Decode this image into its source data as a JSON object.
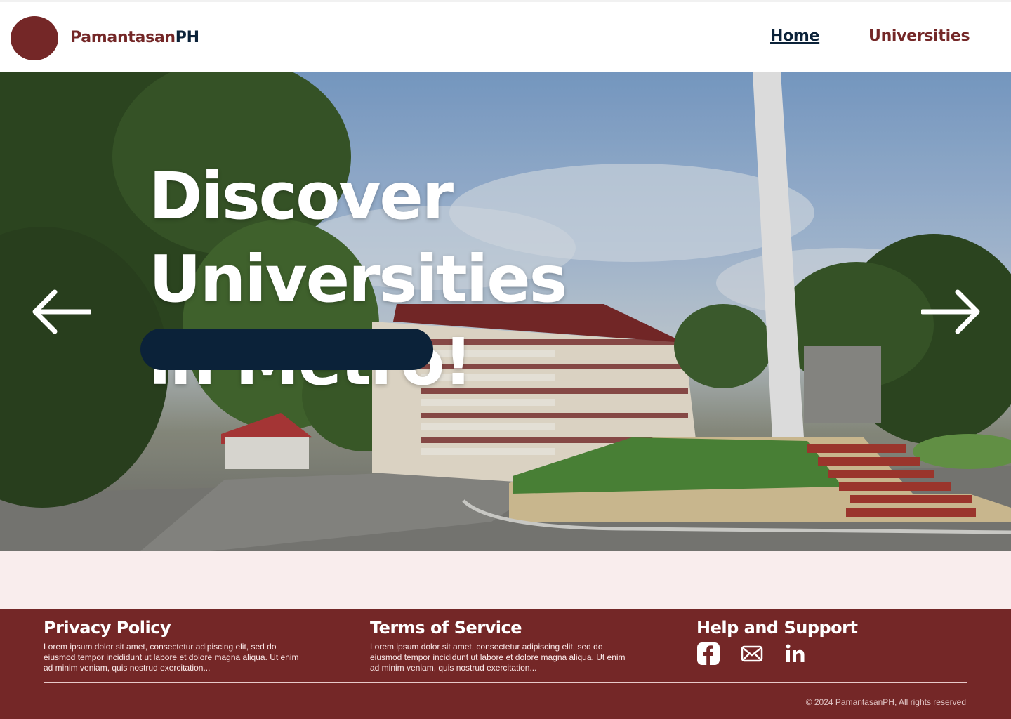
{
  "header": {
    "brand_part1": "Pamantasan",
    "brand_part2": "PH",
    "nav": {
      "home": "Home",
      "universities": "Universities"
    }
  },
  "hero": {
    "title_line1": "Discover Universities",
    "title_line2": "in Metro!",
    "cta_label": "",
    "prev_icon": "arrow-left-icon",
    "next_icon": "arrow-right-icon"
  },
  "footer": {
    "privacy": {
      "title": "Privacy Policy",
      "text": "Lorem ipsum dolor sit amet, consectetur adipiscing elit, sed do eiusmod tempor incididunt ut labore et dolore magna aliqua. Ut enim ad minim veniam, quis nostrud exercitation..."
    },
    "terms": {
      "title": "Terms of Service",
      "text": "Lorem ipsum dolor sit amet, consectetur adipiscing elit, sed do eiusmod tempor incididunt ut labore et dolore magna aliqua. Ut enim ad minim veniam, quis nostrud exercitation..."
    },
    "help": {
      "title": "Help and Support",
      "socials": [
        "facebook-icon",
        "mail-icon",
        "linkedin-icon"
      ]
    },
    "copyright": "© 2024 PamantasanPH, All rights reserved"
  },
  "colors": {
    "primary": "#742727",
    "navy": "#0b2239",
    "band": "#f9eded",
    "white": "#ffffff"
  }
}
